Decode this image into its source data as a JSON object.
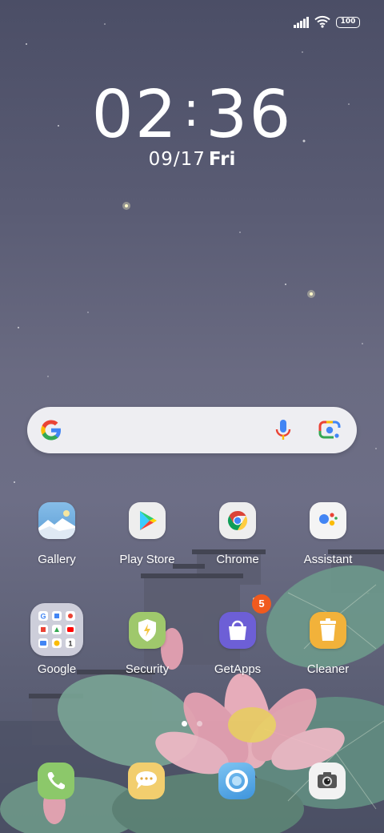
{
  "status_bar": {
    "battery_level": "100",
    "icons": [
      "signal-icon",
      "wifi-icon",
      "battery-icon"
    ]
  },
  "lock_clock": {
    "time_hours": "02",
    "time_minutes": "36",
    "date": "09/17",
    "day": "Fri"
  },
  "search_bar": {
    "icons": [
      "google-g-icon",
      "microphone-icon",
      "google-lens-icon"
    ]
  },
  "apps_row1": [
    {
      "label": "Gallery",
      "icon": "gallery-icon",
      "color": "#7bb0e0"
    },
    {
      "label": "Play Store",
      "icon": "play-store-icon",
      "color": "#eeeeee"
    },
    {
      "label": "Chrome",
      "icon": "chrome-icon",
      "color": "#eeeeee"
    },
    {
      "label": "Assistant",
      "icon": "assistant-icon",
      "color": "#f4f4f4"
    }
  ],
  "apps_row2": [
    {
      "label": "Google",
      "icon": "google-folder-icon",
      "color": "#d8d8e0"
    },
    {
      "label": "Security",
      "icon": "security-icon",
      "color": "#9fc86c"
    },
    {
      "label": "GetApps",
      "icon": "getapps-icon",
      "color": "#6d5fd6",
      "badge": "5"
    },
    {
      "label": "Cleaner",
      "icon": "cleaner-icon",
      "color": "#f2b23a"
    }
  ],
  "page_indicator": {
    "pages": 2,
    "current": 1
  },
  "dock": [
    {
      "icon": "phone-icon",
      "color": "#8cc86a"
    },
    {
      "icon": "messages-icon",
      "color": "#f2ce6e"
    },
    {
      "icon": "browser-icon",
      "color": "#5eaee8"
    },
    {
      "icon": "camera-icon",
      "color": "#f2f2f2"
    }
  ],
  "colors": {
    "background_top": "#4b4e66",
    "background_mid": "#6d6e86",
    "badge": "#f05a1e",
    "search_bar": "#eeeef2"
  }
}
